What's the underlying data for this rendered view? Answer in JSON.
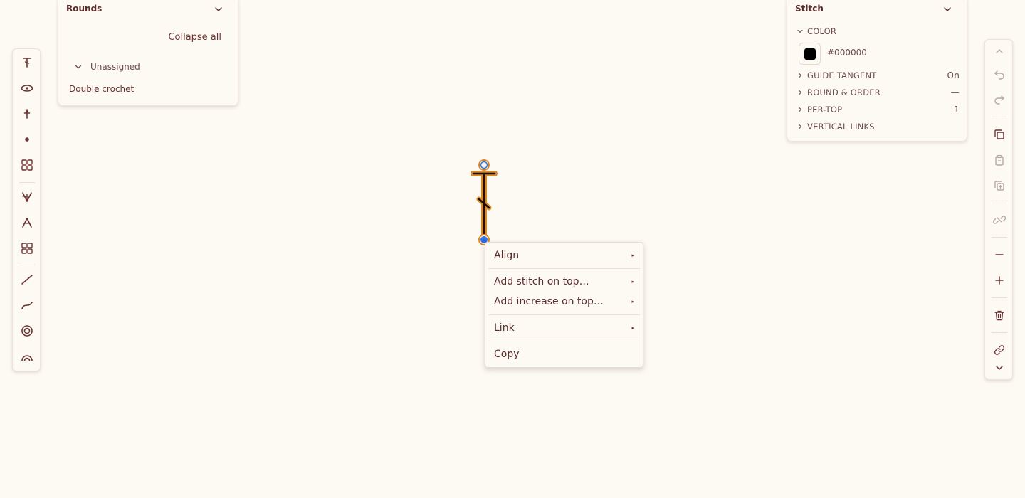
{
  "rounds_panel": {
    "title": "Rounds",
    "collapse_all": "Collapse all",
    "group_label": "Unassigned",
    "items": [
      "Double crochet"
    ]
  },
  "stitch_panel": {
    "title": "Stitch",
    "color_label": "COLOR",
    "color_hex": "#000000",
    "sections": [
      {
        "label": "GUIDE TANGENT",
        "value": "On"
      },
      {
        "label": "ROUND & ORDER",
        "value": "—"
      },
      {
        "label": "PER-TOP",
        "value": "1"
      },
      {
        "label": "VERTICAL LINKS",
        "value": ""
      }
    ]
  },
  "left_toolbar": {
    "tools": [
      "double-crochet-icon",
      "oval-stitch-icon",
      "single-crochet-icon",
      "dot-icon",
      "grid-icon",
      "increase-icon",
      "decrease-icon",
      "grid-icon",
      "line-icon",
      "curve-icon",
      "ring-icon",
      "arc-icon"
    ]
  },
  "right_toolbar": {
    "tools": [
      "chevron-up-icon",
      "undo-icon",
      "redo-icon",
      "copy-icon",
      "paste-icon",
      "duplicate-icon",
      "unlink-icon",
      "minus-icon",
      "plus-icon",
      "trash-icon",
      "link-icon",
      "chevron-down-icon"
    ]
  },
  "context_menu": {
    "items": [
      {
        "label": "Align",
        "submenu": true
      },
      {
        "label": "Add stitch on top…",
        "submenu": true
      },
      {
        "label": "Add increase on top…",
        "submenu": true
      },
      {
        "label": "Link",
        "submenu": true
      },
      {
        "label": "Copy",
        "submenu": false
      }
    ],
    "arrow_glyph": "▸"
  },
  "colors": {
    "background": "#fdf9f3",
    "text": "#5a2d2d",
    "selection": "#d98a2b",
    "handle": "#2f6fe0"
  }
}
